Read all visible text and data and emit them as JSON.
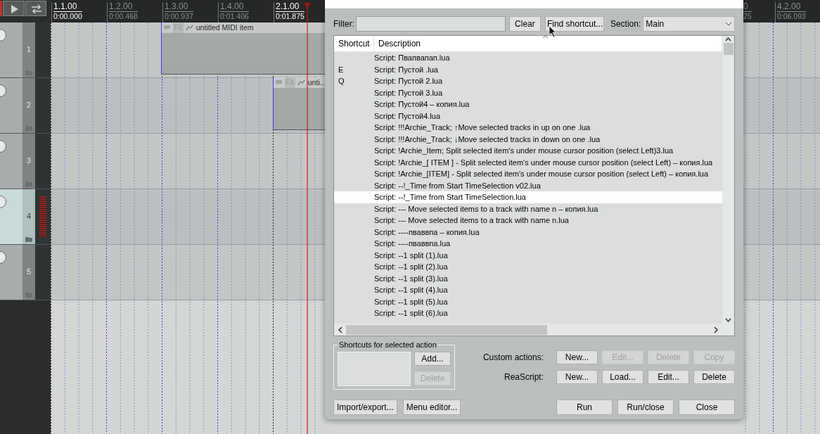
{
  "ruler": {
    "left_markers": [
      {
        "bar": "1.1.00",
        "time": "0:00.000",
        "kind": "bar"
      },
      {
        "bar": "1.2.00",
        "time": "0:00.468",
        "kind": "beat"
      },
      {
        "bar": "1.3.00",
        "time": "0:00.937",
        "kind": "beat"
      },
      {
        "bar": "1.4.00",
        "time": "0:01.406",
        "kind": "beat"
      },
      {
        "bar": "2.1.00",
        "time": "0:01.875",
        "kind": "bar"
      }
    ],
    "right_markers": [
      {
        "bar": "0",
        "time": "25",
        "kind": "cut"
      },
      {
        "bar": "4.2.00",
        "time": "0:06.093",
        "kind": "beat"
      }
    ]
  },
  "tracks": [
    {
      "number": "1",
      "selected": false
    },
    {
      "number": "2",
      "selected": false
    },
    {
      "number": "3",
      "selected": false
    },
    {
      "number": "4",
      "selected": true
    },
    {
      "number": "5",
      "selected": false
    }
  ],
  "items": [
    {
      "fx": "FX",
      "title": "untitled MIDI item"
    },
    {
      "fx": "FX",
      "title": "unti..."
    }
  ],
  "actions": {
    "filter_label": "Filter:",
    "clear_button": "Clear",
    "find_button": "Find shortcut...",
    "section_label": "Section:",
    "section_value": "Main",
    "columns": [
      "Shortcut",
      "Description"
    ],
    "rows": [
      {
        "description": "Script: Пвапвапап.lua",
        "selected": false
      },
      {
        "shortcut": "E",
        "description": "Script: Пустой .lua",
        "selected": false
      },
      {
        "shortcut": "Q",
        "description": "Script: Пустой 2.lua",
        "selected": false
      },
      {
        "description": "Script: Пустой 3.lua",
        "selected": false
      },
      {
        "description": "Script: Пустой4 – копия.lua",
        "selected": false
      },
      {
        "description": "Script: Пустой4.lua",
        "selected": false
      },
      {
        "description": "Script: !!!Archie_Track; ↑Move selected tracks in up on one .lua",
        "selected": false
      },
      {
        "description": "Script: !!!Archie_Track; ↓Move selected tracks in down on one .lua",
        "selected": false
      },
      {
        "description": "Script: !Archie_Item; Split selected item's under mouse cursor position (select Left)3.lua",
        "selected": false
      },
      {
        "description": "Script: !Archie_[ ITEM ] - Split selected item's under mouse cursor position (select Left) – копия.lua",
        "selected": false
      },
      {
        "description": "Script: !Archie_[ITEM] - Split selected item's under mouse cursor position (select Left) – копия.lua",
        "selected": false
      },
      {
        "description": "Script: --!_Time from Start TimeSelection v02.lua",
        "selected": false
      },
      {
        "description": "Script: --!_Time from Start TimeSelection.lua",
        "selected": true
      },
      {
        "description": "Script: --- Move selected items to a track with name n – копия.lua",
        "selected": false
      },
      {
        "description": "Script: --- Move selected items to a track with name n.lua",
        "selected": false
      },
      {
        "description": "Script: ----пваввпа – копия.lua",
        "selected": false
      },
      {
        "description": "Script: ----пваввпа.lua",
        "selected": false
      },
      {
        "description": "Script: --1 split (1).lua",
        "selected": false
      },
      {
        "description": "Script: --1 split (2).lua",
        "selected": false
      },
      {
        "description": "Script: --1 split (3).lua",
        "selected": false
      },
      {
        "description": "Script: --1 split (4).lua",
        "selected": false
      },
      {
        "description": "Script: --1 split (5).lua",
        "selected": false
      },
      {
        "description": "Script: --1 split (6).lua",
        "selected": false
      }
    ],
    "shortcuts_group": {
      "title": "Shortcuts for selected action",
      "buttons": [
        {
          "label": "Add...",
          "disabled": false
        },
        {
          "label": "Delete",
          "disabled": true
        }
      ]
    },
    "custom_actions": {
      "label": "Custom actions:",
      "buttons": [
        {
          "label": "New...",
          "disabled": false
        },
        {
          "label": "Edit...",
          "disabled": true
        },
        {
          "label": "Delete",
          "disabled": true
        },
        {
          "label": "Copy",
          "disabled": true
        }
      ]
    },
    "reascript": {
      "label": "ReaScript:",
      "buttons": [
        {
          "label": "New...",
          "disabled": false
        },
        {
          "label": "Load...",
          "disabled": false
        },
        {
          "label": "Edit...",
          "disabled": false
        },
        {
          "label": "Delete",
          "disabled": false
        }
      ]
    },
    "footer_left": [
      "Import/export...",
      "Menu editor..."
    ],
    "footer_right": [
      "Run",
      "Run/close",
      "Close"
    ]
  }
}
